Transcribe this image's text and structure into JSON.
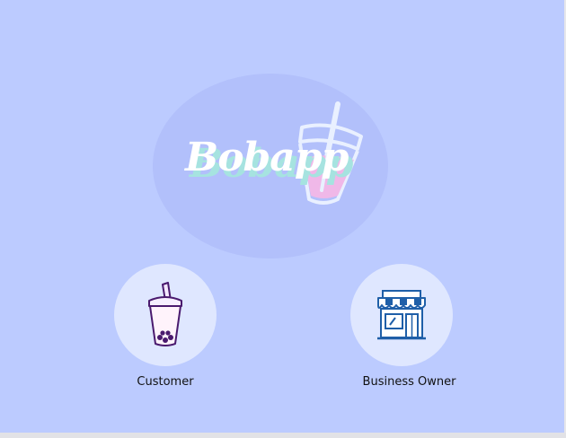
{
  "app": {
    "logo_text": "Bobapp"
  },
  "roles": [
    {
      "label": "Customer",
      "icon": "bubble-tea-icon"
    },
    {
      "label": "Business Owner",
      "icon": "storefront-icon"
    }
  ],
  "colors": {
    "background": "#bccbff",
    "logo_circle": "#b2c0fb",
    "role_circle": "#dfe7ff",
    "logo_shadow": "#a6e3e0",
    "drink_pink": "#f0b8e8",
    "icon_stroke": "#1f5fa8",
    "customer_icon_stroke": "#4a1a6e"
  }
}
